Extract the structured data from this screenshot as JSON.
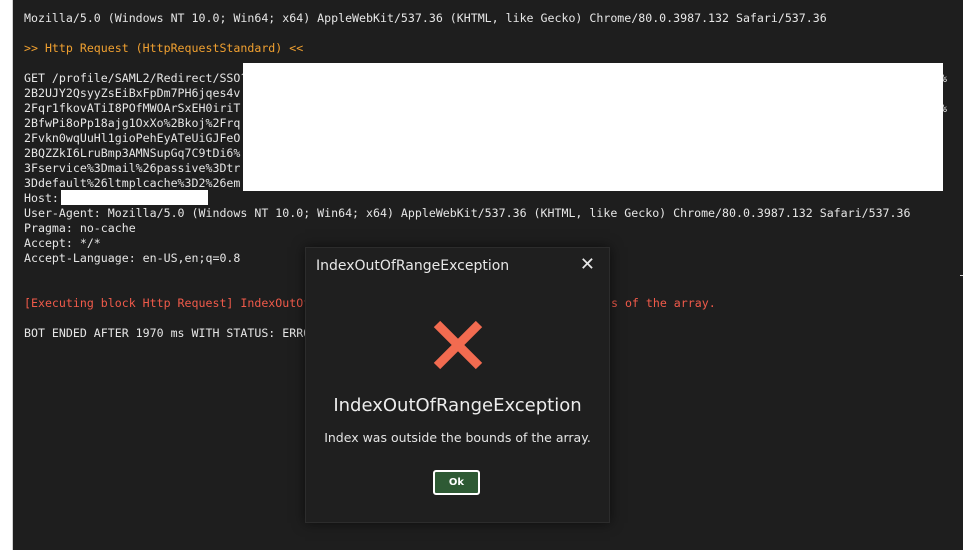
{
  "console": {
    "lines": {
      "user_agent_top": "Mozilla/5.0 (Windows NT 10.0; Win64; x64) AppleWebKit/537.36 (KHTML, like Gecko) Chrome/80.0.3987.132 Safari/537.36",
      "http_request_header": ">> Http Request (HttpRequestStandard) <<",
      "get_line": "GET /profile/SAML2/Redirect/SSO?",
      "url_2": "2B2UJY2QsyyZsEiBxFpDm7PH6jqes4v",
      "url_3": "2Fqr1fkovATiI8POfMWOArSxEH0iriT",
      "url_4": "2BfwPi8oPp18ajg1OxXo%2Bkoj%2Frq",
      "url_5": "2Fvkn0wqUuHl1gioPehEyATeUiGJFeO",
      "url_6": "2BQZZkI6LruBmp3AMNSupGq7C9tDi6%",
      "url_7": "3Fservice%3Dmail%26passive%3Dtr",
      "url_8": "3Ddefault%26ltmplcache%3D2%26em",
      "url_2_tail": "%",
      "url_3_tail": "%",
      "host": "Host:",
      "user_agent": "User-Agent: Mozilla/5.0 (Windows NT 10.0; Win64; x64) AppleWebKit/537.36 (KHTML, like Gecko) Chrome/80.0.3987.132 Safari/537.36",
      "pragma": "Pragma: no-cache",
      "accept": "Accept: */*",
      "accept_language": "Accept-Language: en-US,en;q=0.8",
      "error_start": "[Executing block Http Request] IndexOutOf",
      "error_end": "ds of the array.",
      "bot_ended": "BOT ENDED AFTER 1970 ms WITH STATUS: ERRO"
    }
  },
  "dialog": {
    "title": "IndexOutOfRangeException",
    "close_glyph": "✕",
    "icon": "error-x-icon",
    "heading": "IndexOutOfRangeException",
    "message": "Index was outside the bounds of the array.",
    "ok_label": "Ok"
  },
  "colors": {
    "console_bg": "#1e1e1e",
    "console_text": "#e6e6e6",
    "section_header": "#f0a030",
    "error_text": "#f05a4a",
    "error_icon": "#f26b50",
    "ok_button": "#2e5a34"
  }
}
